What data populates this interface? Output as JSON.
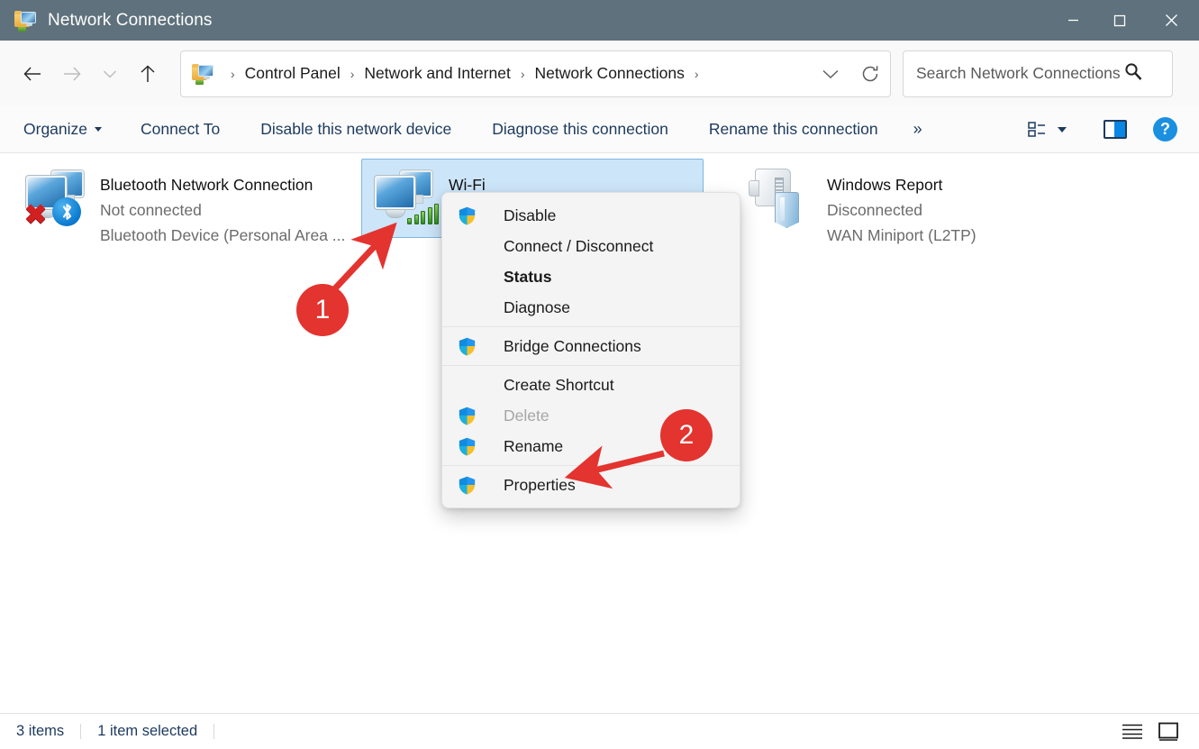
{
  "window": {
    "title": "Network Connections",
    "icon": "network-folder-icon",
    "minimize_label": "Minimize",
    "maximize_label": "Maximize",
    "close_label": "Close"
  },
  "navigation": {
    "back_label": "Back",
    "forward_label": "Forward",
    "recent_label": "Recent locations",
    "up_label": "Up",
    "breadcrumbs": [
      {
        "label": "Control Panel"
      },
      {
        "label": "Network and Internet"
      },
      {
        "label": "Network Connections"
      }
    ],
    "separator": "›",
    "dropdown_label": "Previous locations",
    "refresh_label": "Refresh"
  },
  "search": {
    "placeholder": "Search Network Connections",
    "value": "",
    "icon": "search-icon"
  },
  "toolbar": {
    "organize": "Organize",
    "connect_to": "Connect To",
    "disable_device": "Disable this network device",
    "diagnose": "Diagnose this connection",
    "rename": "Rename this connection",
    "overflow": "»",
    "view_label": "View",
    "preview_pane_label": "Preview pane",
    "help_label": "?"
  },
  "connections": [
    {
      "name": "Bluetooth Network Connection",
      "status": "Not connected",
      "device": "Bluetooth Device (Personal Area ...",
      "icon": "bluetooth-network-icon",
      "selected": false
    },
    {
      "name": "Wi-Fi",
      "status": "",
      "device": "",
      "icon": "wifi-network-icon",
      "selected": true
    },
    {
      "name": "Windows Report",
      "status": "Disconnected",
      "device": "WAN Miniport (L2TP)",
      "icon": "wan-miniport-icon",
      "selected": false
    }
  ],
  "context_menu": {
    "groups": [
      {
        "items": [
          {
            "label": "Disable",
            "shield": true,
            "bold": false,
            "disabled": false
          },
          {
            "label": "Connect / Disconnect",
            "shield": false,
            "bold": false,
            "disabled": false
          },
          {
            "label": "Status",
            "shield": false,
            "bold": true,
            "disabled": false
          },
          {
            "label": "Diagnose",
            "shield": false,
            "bold": false,
            "disabled": false
          }
        ]
      },
      {
        "items": [
          {
            "label": "Bridge Connections",
            "shield": true,
            "bold": false,
            "disabled": false
          }
        ]
      },
      {
        "items": [
          {
            "label": "Create Shortcut",
            "shield": false,
            "bold": false,
            "disabled": false
          },
          {
            "label": "Delete",
            "shield": true,
            "bold": false,
            "disabled": true
          },
          {
            "label": "Rename",
            "shield": true,
            "bold": false,
            "disabled": false
          }
        ]
      },
      {
        "items": [
          {
            "label": "Properties",
            "shield": true,
            "bold": false,
            "disabled": false
          }
        ]
      }
    ]
  },
  "annotations": [
    {
      "number": "1",
      "target": "wifi-connection-tile"
    },
    {
      "number": "2",
      "target": "context-menu-item-properties"
    }
  ],
  "statusbar": {
    "item_count": "3 items",
    "selection": "1 item selected",
    "details_view_label": "Details view",
    "large_icons_view_label": "Large icons view"
  },
  "colors": {
    "titlebar": "#5e717c",
    "accent": "#0a86e4",
    "selection": "#cce5f8",
    "toolbar_text": "#1c3a5e",
    "annotation": "#e3342f"
  }
}
